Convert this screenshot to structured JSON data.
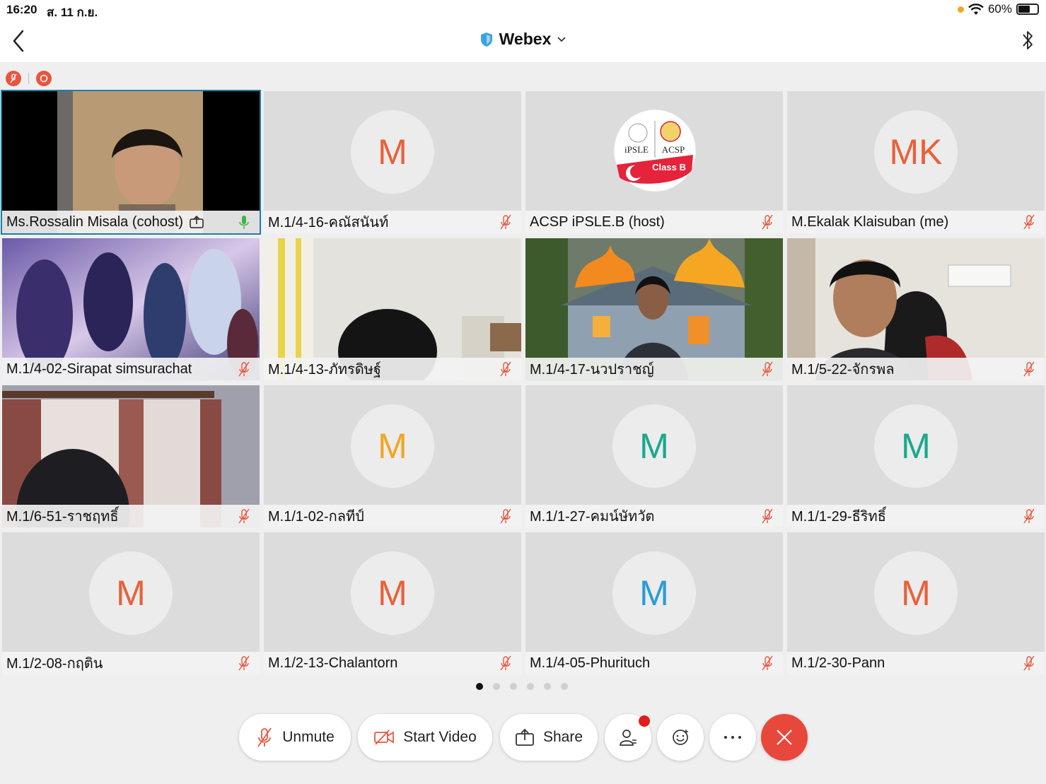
{
  "status_bar": {
    "time": "16:20",
    "date": "ส. 11 ก.ย.",
    "battery": "60%",
    "battery_level": 0.6
  },
  "nav": {
    "title": "Webex",
    "back_icon": "chevron-left-icon",
    "bluetooth_icon": "bluetooth-icon"
  },
  "tiles": [
    {
      "name": "Ms.Rossalin Misala (cohost)",
      "type": "video",
      "mic": "active",
      "sharing": true,
      "active": true
    },
    {
      "name": "M.1/4-16-คณัสนันท์",
      "type": "avatar",
      "initials": "M",
      "color": "#e8613a",
      "mic": "muted"
    },
    {
      "name": "ACSP iPSLE.B (host)",
      "type": "logo",
      "mic": "muted",
      "logo_text_1": "iPSLE",
      "logo_text_2": "ACSP",
      "logo_text_3": "Class B"
    },
    {
      "name": "M.Ekalak Klaisuban (me)",
      "type": "avatar",
      "initials": "MK",
      "color": "#e8613a",
      "mic": "muted"
    },
    {
      "name": "M.1/4-02-Sirapat simsurachat",
      "type": "video",
      "mic": "muted"
    },
    {
      "name": "M.1/4-13-ภัทรดิษฐ์",
      "type": "video",
      "mic": "muted"
    },
    {
      "name": "M.1/4-17-นวปราชญ์",
      "type": "video",
      "mic": "muted"
    },
    {
      "name": "M.1/5-22-จักรพล",
      "type": "video",
      "mic": "muted"
    },
    {
      "name": "M.1/6-51-ราชฤทธิ์",
      "type": "video",
      "mic": "muted"
    },
    {
      "name": "M.1/1-02-กลทีป์",
      "type": "avatar",
      "initials": "M",
      "color": "#f2a623",
      "mic": "muted"
    },
    {
      "name": "M.1/1-27-คมน์ษัทวัต",
      "type": "avatar",
      "initials": "M",
      "color": "#1aa88e",
      "mic": "muted"
    },
    {
      "name": "M.1/1-29-ธีริทธิ์",
      "type": "avatar",
      "initials": "M",
      "color": "#1aa88e",
      "mic": "muted"
    },
    {
      "name": "M.1/2-08-กฤติน",
      "type": "avatar",
      "initials": "M",
      "color": "#e8613a",
      "mic": "muted"
    },
    {
      "name": "M.1/2-13-Chalantorn",
      "type": "avatar",
      "initials": "M",
      "color": "#e8613a",
      "mic": "muted"
    },
    {
      "name": "M.1/4-05-Phurituch",
      "type": "avatar",
      "initials": "M",
      "color": "#2a9bd6",
      "mic": "muted"
    },
    {
      "name": "M.1/2-30-Pann",
      "type": "avatar",
      "initials": "M",
      "color": "#e8613a",
      "mic": "muted"
    }
  ],
  "pager": {
    "pages": 6,
    "current": 0
  },
  "controls": {
    "unmute_label": "Unmute",
    "start_video_label": "Start Video",
    "share_label": "Share",
    "participants_icon": "participants-icon",
    "reactions_icon": "emoji-icon",
    "more_icon": "more-icon",
    "leave_icon": "close-icon"
  },
  "colors": {
    "accent_red": "#e8473b",
    "active_border": "#1d7fa6",
    "mic_active": "#3bb54a",
    "mute_red": "#e8553f"
  }
}
